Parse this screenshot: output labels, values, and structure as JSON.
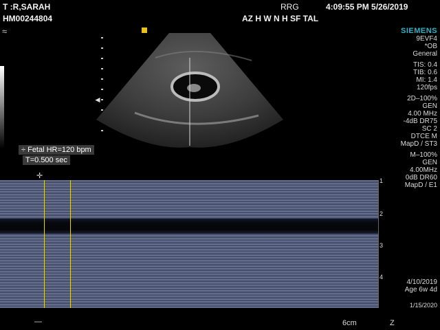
{
  "header": {
    "patient_name": "T  :R,SARAH",
    "patient_id": "HM00244804",
    "operator": "RRG",
    "datetime": "4:09:55 PM 5/26/2019",
    "institution": "AZ   H  W   N   H  SF  TAL"
  },
  "side_panel": {
    "brand": "SIEMENS",
    "lines": [
      "9EVF4",
      "*OB",
      "General",
      "",
      "TIS: 0.4",
      "TIB: 0.6",
      "MI: 1.4",
      "120fps",
      "",
      "2D–100%",
      "GEN",
      "4.00 MHz",
      "-4dB DR75",
      "SC 2",
      "DTCE M",
      "MapD / ST3",
      "",
      "M–100%",
      "GEN",
      "4.00MHz",
      "0dB DR60",
      "MapD / E1"
    ],
    "date1": "4/10/2019",
    "age": "Age 6w 4d",
    "date2": "1/15/2020"
  },
  "measurement": {
    "hr": "÷ Fetal HR=120 bpm",
    "t": "T=0.500 sec"
  },
  "depth_ticks": [
    "1",
    "2",
    "3",
    "4"
  ],
  "footer": {
    "depth": "6cm",
    "z": "Z",
    "dash": "—"
  },
  "icons": {
    "top_left": "≈",
    "marker": "■"
  }
}
